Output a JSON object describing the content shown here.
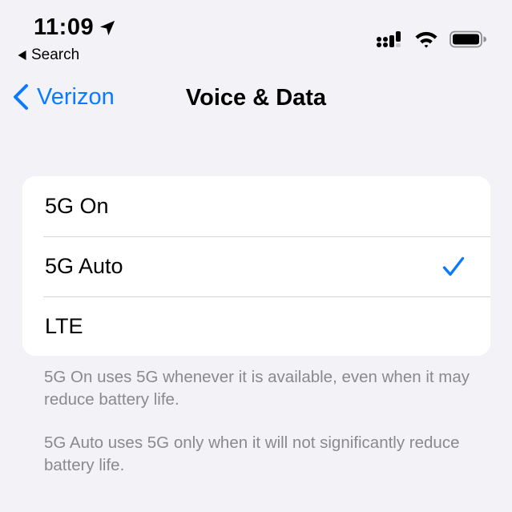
{
  "status_bar": {
    "time": "11:09",
    "back_label": "Search",
    "icons": [
      "location-arrow-icon",
      "cellular-signal-icon",
      "wifi-icon",
      "battery-icon"
    ]
  },
  "nav": {
    "back_label": "Verizon",
    "title": "Voice & Data"
  },
  "options": [
    {
      "label": "5G On",
      "selected": false
    },
    {
      "label": "5G Auto",
      "selected": true
    },
    {
      "label": "LTE",
      "selected": false
    }
  ],
  "footer": {
    "note1": "5G On uses 5G whenever it is available, even when it may reduce battery life.",
    "note2": "5G Auto uses 5G only when it will not significantly reduce battery life."
  },
  "colors": {
    "accent": "#0a7aff",
    "background": "#f2f2f7",
    "footnote": "#8a8a8e"
  }
}
